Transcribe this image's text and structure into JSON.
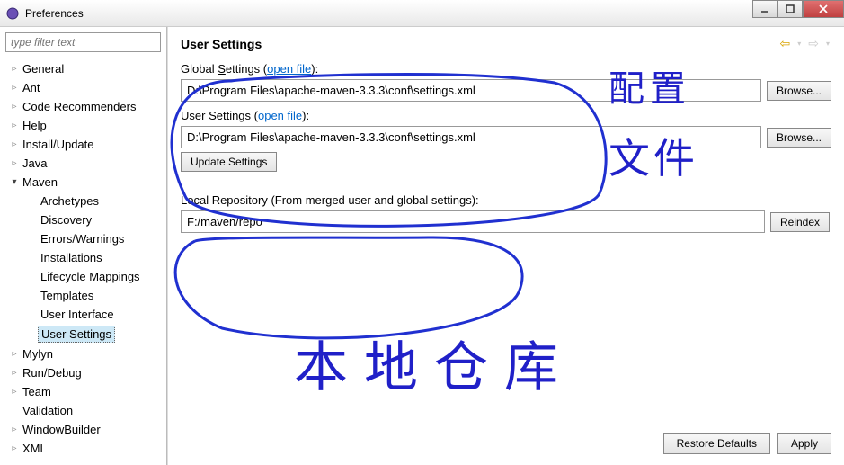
{
  "window": {
    "title": "Preferences"
  },
  "sidebar": {
    "filter_placeholder": "type filter text",
    "items": [
      {
        "label": "General",
        "state": "collapsed",
        "level": 1
      },
      {
        "label": "Ant",
        "state": "collapsed",
        "level": 1
      },
      {
        "label": "Code Recommenders",
        "state": "collapsed",
        "level": 1
      },
      {
        "label": "Help",
        "state": "collapsed",
        "level": 1
      },
      {
        "label": "Install/Update",
        "state": "collapsed",
        "level": 1
      },
      {
        "label": "Java",
        "state": "collapsed",
        "level": 1
      },
      {
        "label": "Maven",
        "state": "expanded",
        "level": 1
      },
      {
        "label": "Archetypes",
        "state": "leaf",
        "level": 2
      },
      {
        "label": "Discovery",
        "state": "leaf",
        "level": 2
      },
      {
        "label": "Errors/Warnings",
        "state": "leaf",
        "level": 2
      },
      {
        "label": "Installations",
        "state": "leaf",
        "level": 2
      },
      {
        "label": "Lifecycle Mappings",
        "state": "leaf",
        "level": 2
      },
      {
        "label": "Templates",
        "state": "leaf",
        "level": 2
      },
      {
        "label": "User Interface",
        "state": "leaf",
        "level": 2
      },
      {
        "label": "User Settings",
        "state": "leaf",
        "level": 2,
        "selected": true
      },
      {
        "label": "Mylyn",
        "state": "collapsed",
        "level": 1
      },
      {
        "label": "Run/Debug",
        "state": "collapsed",
        "level": 1
      },
      {
        "label": "Team",
        "state": "collapsed",
        "level": 1
      },
      {
        "label": "Validation",
        "state": "leaf",
        "level": 1
      },
      {
        "label": "WindowBuilder",
        "state": "collapsed",
        "level": 1
      },
      {
        "label": "XML",
        "state": "collapsed",
        "level": 1
      }
    ]
  },
  "main": {
    "title": "User Settings",
    "global_label_pre": "Global ",
    "global_label_u": "S",
    "global_label_post": "ettings (",
    "open_file": "open file",
    "close_paren": "):",
    "global_value": "D:\\Program Files\\apache-maven-3.3.3\\conf\\settings.xml",
    "user_label_pre": "User ",
    "user_label_u": "S",
    "user_label_post": "ettings (",
    "user_value": "D:\\Program Files\\apache-maven-3.3.3\\conf\\settings.xml",
    "browse": "Browse...",
    "update": "Update Settings",
    "local_repo_label": "Local Repository (From merged user and global settings):",
    "local_repo_value": "F:/maven/repo",
    "reindex": "Reindex",
    "restore": "Restore Defaults",
    "apply": "Apply"
  },
  "annotations": {
    "top_right": "配置",
    "mid_right": "文件",
    "bottom": "本地仓库"
  }
}
